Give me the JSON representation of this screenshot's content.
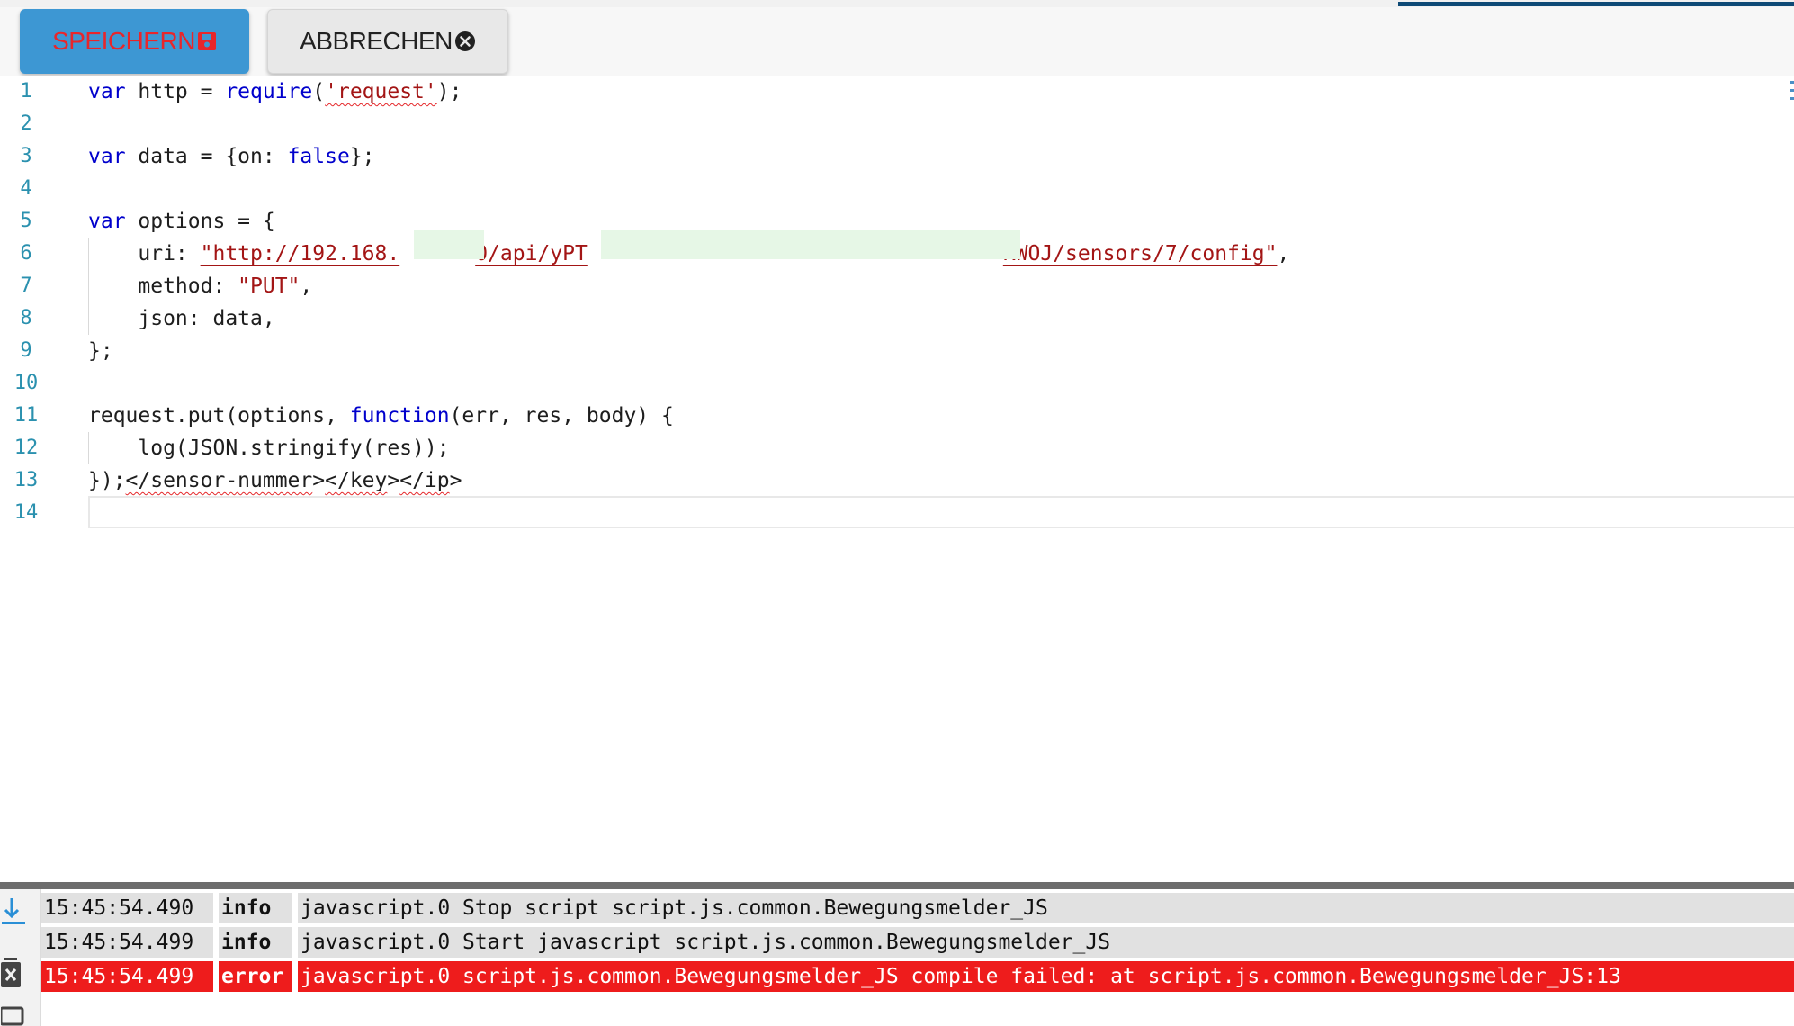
{
  "toolbar": {
    "save_label": "SPEICHERN",
    "cancel_label": "ABBRECHEN",
    "save_icon": "floppy-disk-icon",
    "cancel_icon": "close-circle-icon"
  },
  "editor": {
    "line_numbers": [
      "1",
      "2",
      "3",
      "4",
      "5",
      "6",
      "7",
      "8",
      "9",
      "10",
      "11",
      "12",
      "13",
      "14"
    ],
    "lines": {
      "l1": {
        "kw": "var",
        "a": " http = ",
        "fn": "require",
        "b": "(",
        "str": "'request'",
        "c": ");"
      },
      "l3": {
        "kw": "var",
        "a": " data = {on: ",
        "kw2": "false",
        "b": "};"
      },
      "l5": {
        "kw": "var",
        "a": " options = {"
      },
      "l6": {
        "key": "    uri: ",
        "str_a": "\"http://192.168.",
        "str_b": "0/api/yPT",
        "str_c": "KWOJ/sensors/7/config\"",
        "tail": ","
      },
      "l7": {
        "key": "    method: ",
        "str": "\"PUT\"",
        "tail": ","
      },
      "l8": {
        "text": "    json: data,"
      },
      "l9": {
        "text": "};"
      },
      "l11": {
        "a": "request.put(options, ",
        "kw": "function",
        "b": "(err, res, body) {"
      },
      "l12": {
        "text": "    log(JSON.stringify(res));"
      },
      "l13": {
        "a": "});",
        "t1": "</sensor-nummer",
        "b": ">",
        "t2": "</key",
        "c": ">",
        "t3": "</ip",
        "d": ">"
      }
    }
  },
  "log": {
    "rows": [
      {
        "time": "15:45:54.490",
        "level": "info",
        "message": "javascript.0 Stop script script.js.common.Bewegungsmelder_JS"
      },
      {
        "time": "15:45:54.499",
        "level": "info",
        "message": "javascript.0 Start javascript script.js.common.Bewegungsmelder_JS"
      },
      {
        "time": "15:45:54.499",
        "level": "error",
        "message": "javascript.0 script.js.common.Bewegungsmelder_JS compile failed: at script.js.common.Bewegungsmelder_JS:13"
      }
    ],
    "sidebar_icons": [
      "scroll-down-icon",
      "clear-log-icon",
      "copy-log-icon"
    ]
  },
  "colors": {
    "save_button_bg": "#3d97d3",
    "save_button_text": "#e8262b",
    "keyword": "#0000cc",
    "string": "#a31515",
    "line_number": "#2b91af",
    "error_row": "#ee1c1c",
    "progress": "#0e4a76"
  }
}
